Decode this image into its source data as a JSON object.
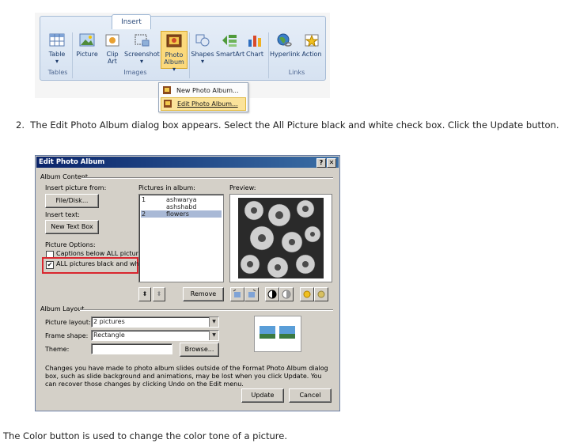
{
  "ribbon": {
    "tab": "Insert",
    "buttons": [
      {
        "label": "Table",
        "sub": "▾"
      },
      {
        "label": "Picture",
        "sub": ""
      },
      {
        "label": "Clip",
        "sub": "Art"
      },
      {
        "label": "Screenshot",
        "sub": "▾"
      },
      {
        "label": "Photo",
        "sub": "Album ▾"
      },
      {
        "label": "Shapes",
        "sub": "▾"
      },
      {
        "label": "SmartArt",
        "sub": ""
      },
      {
        "label": "Chart",
        "sub": ""
      },
      {
        "label": "Hyperlink",
        "sub": ""
      },
      {
        "label": "Action",
        "sub": ""
      }
    ],
    "groups": [
      "Tables",
      "Images",
      "Links"
    ],
    "menu": [
      "New Photo Album...",
      "Edit Photo Album..."
    ]
  },
  "step": {
    "number": "2.",
    "text": "The Edit Photo Album dialog box appears. Select the All Picture black and white check box. Click the Update button."
  },
  "dialog": {
    "title": "Edit Photo Album",
    "help": "?",
    "close": "✕",
    "album_content": "Album Content",
    "insert_picture_from": "Insert picture from:",
    "file_disk": "File/Disk...",
    "insert_text": "Insert text:",
    "new_text_box": "New Text Box",
    "picture_options": "Picture Options:",
    "captions_label": "Captions below ALL pictures",
    "captions_checked": false,
    "bw_label": "ALL pictures black and white",
    "bw_checked": true,
    "check_mark": "✔",
    "pictures_in_album": "Pictures in album:",
    "pictures": [
      {
        "n": "1",
        "name": "ashwarya"
      },
      {
        "n": "",
        "name": "ashshabd"
      },
      {
        "n": "2",
        "name": "flowers"
      }
    ],
    "preview": "Preview:",
    "up_arrow": "⬍",
    "down_arrow": "⬍",
    "remove": "Remove",
    "album_layout": "Album Layout",
    "picture_layout_label": "Picture layout:",
    "picture_layout_value": "2 pictures",
    "frame_shape_label": "Frame shape:",
    "frame_shape_value": "Rectangle",
    "theme_label": "Theme:",
    "theme_value": "",
    "browse": "Browse...",
    "notice": "Changes you have made to photo album slides outside of the Format Photo Album dialog box, such as slide background and animations, may be lost when you click Update. You can recover those changes by clicking Undo on the Edit menu.",
    "update": "Update",
    "cancel": "Cancel",
    "highlight_color": "#d9262e"
  },
  "footer": "The Color button is used to change the color tone of a picture."
}
